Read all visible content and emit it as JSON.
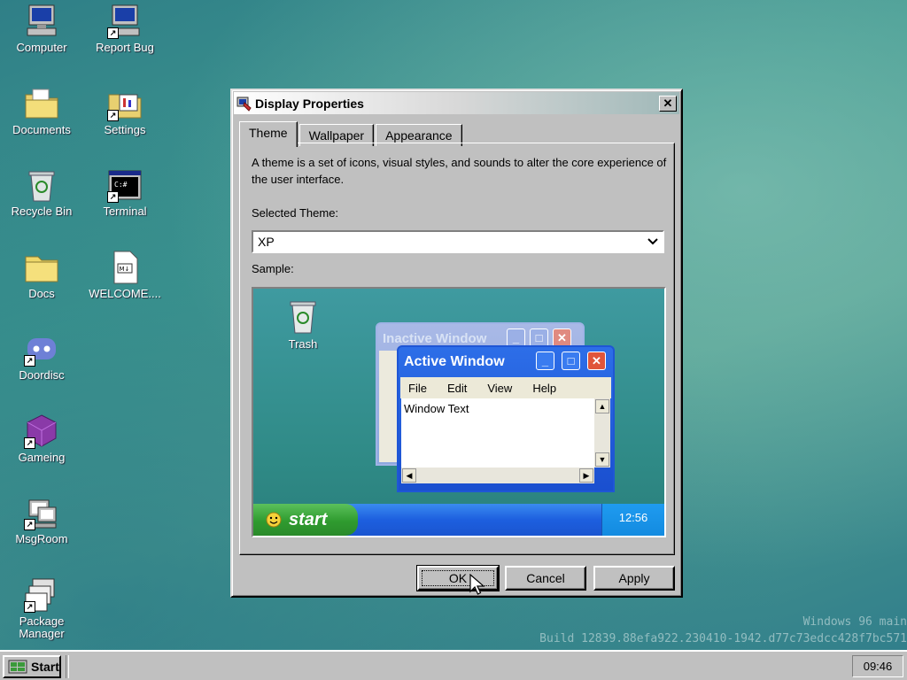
{
  "desktop": {
    "icons": [
      {
        "label": "Computer"
      },
      {
        "label": "Report Bug"
      },
      {
        "label": "Documents"
      },
      {
        "label": "Settings"
      },
      {
        "label": "Recycle Bin"
      },
      {
        "label": "Terminal"
      },
      {
        "label": "Docs"
      },
      {
        "label": "WELCOME...."
      },
      {
        "label": "Doordisc"
      },
      {
        "label": "Gameing"
      },
      {
        "label": "MsgRoom"
      },
      {
        "label": "Package Manager"
      }
    ],
    "watermark": {
      "line1": "Windows 96 main",
      "line2": "Build 12839.88efa922.230410-1942.d77c73edcc428f7bc571"
    }
  },
  "dialog": {
    "title": "Display Properties",
    "close_glyph": "✕",
    "tabs": [
      {
        "label": "Theme",
        "active": true
      },
      {
        "label": "Wallpaper",
        "active": false
      },
      {
        "label": "Appearance",
        "active": false
      }
    ],
    "description": "A theme is a set of icons, visual styles, and sounds to alter the core experience of the user interface.",
    "selected_theme_label": "Selected Theme:",
    "selected_theme_value": "XP",
    "sample_label": "Sample:",
    "sample": {
      "trash_label": "Trash",
      "inactive_title": "Inactive Window",
      "active_title": "Active Window",
      "menu": [
        "File",
        "Edit",
        "View",
        "Help"
      ],
      "window_text": "Window Text",
      "start_label": "start",
      "clock": "12:56"
    },
    "buttons": {
      "ok": "OK",
      "cancel": "Cancel",
      "apply": "Apply"
    }
  },
  "taskbar": {
    "start_label": "Start",
    "clock": "09:46"
  }
}
